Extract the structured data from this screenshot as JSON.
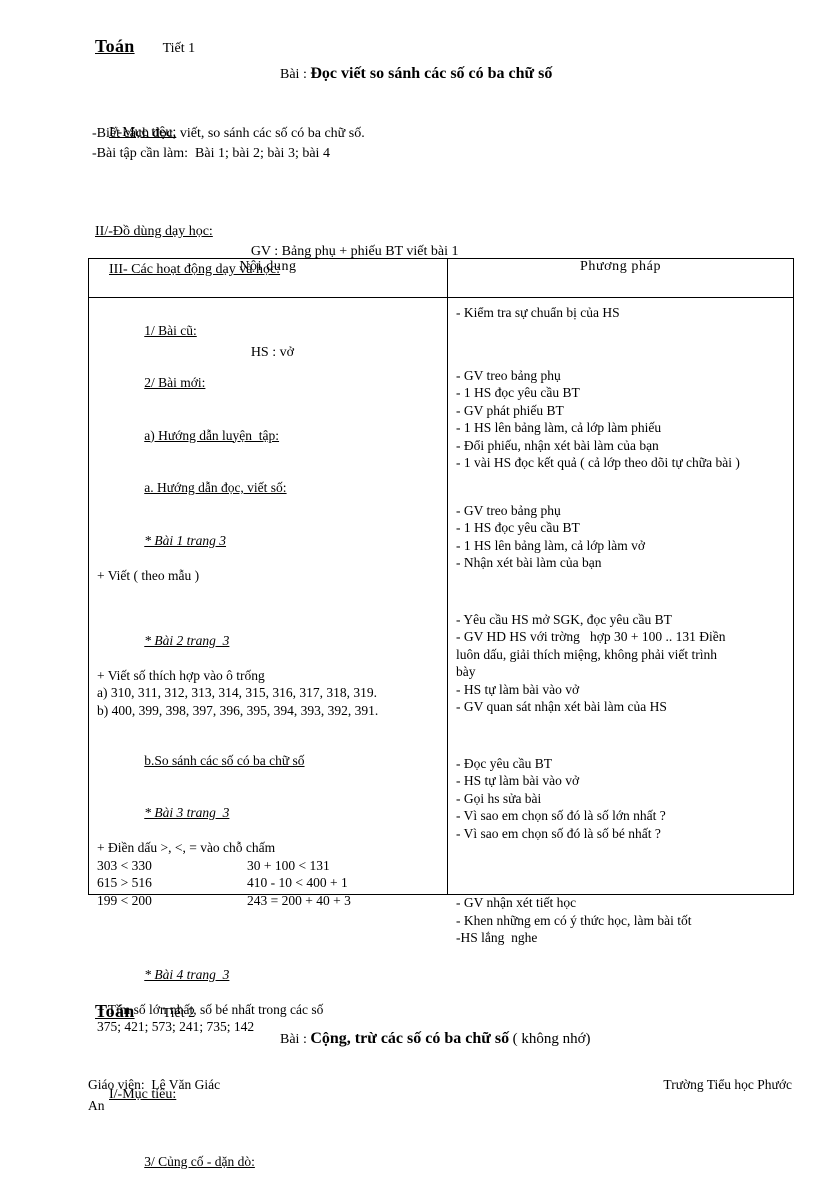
{
  "lesson1": {
    "subject": "Toán",
    "period": "Tiết 1",
    "title_prefix": "Bài :",
    "title_main": "Đọc viết so sánh các số có ba chữ số",
    "title_tail": "",
    "section1_label": "I/-Mục tiêu:",
    "objectives": [
      "-Biết cách đọc, viết, so sánh các số có ba chữ số.",
      "-Bài tập cần làm:  Bài 1; bài 2; bài 3; bài 4"
    ],
    "section2_label": "II/-Đồ dùng dạy học:",
    "materials": [
      "GV : Bảng phụ + phiếu BT viết bài 1",
      "HS : vở"
    ],
    "section3_label": "III- Các hoạt động dạy và học:"
  },
  "table": {
    "headers": {
      "content": "Nội dung",
      "method": "Phương pháp"
    },
    "content_column": {
      "old_lesson": "1/ Bài cũ:",
      "new_lesson": "2/ Bài mới:",
      "part_a": "a) Hướng dẫn luyện  tập:",
      "sub_a": "a. Hướng dẫn đọc, viết số:",
      "ex1_title": "* Bài 1 trang 3",
      "ex1_desc": "+ Viết ( theo mẫu )",
      "ex2_title": "* Bài 2 trang  3",
      "ex2_desc": "+ Viết số thích hợp vào ô trống",
      "ex2_line_a": "a) 310, 311, 312, 313, 314, 315, 316, 317, 318, 319.",
      "ex2_line_b": "b) 400, 399, 398, 397, 396, 395, 394, 393, 392, 391.",
      "part_b": "b.So sánh các số có ba chữ số",
      "ex3_title": "* Bài 3 trang  3",
      "ex3_desc": "+ Điền dấu >, <, = vào chỗ chấm",
      "ex3_pairs": [
        {
          "left": "303 < 330",
          "right": "30 + 100 < 131"
        },
        {
          "left": "615 > 516",
          "right": "410 - 10 < 400 + 1"
        },
        {
          "left": "199 < 200",
          "right": "243 = 200 + 40 + 3"
        }
      ],
      "ex4_title": "* Bài 4 trang  3",
      "ex4_desc": "+ Tìm số lớn nhất, số bé nhất trong các số",
      "ex4_numbers": "375; 421; 573; 241; 735; 142",
      "closing": "3/ Củng cố - dặn dò:"
    },
    "method_column": {
      "group1": [
        "- Kiểm tra sự chuẩn bị của HS"
      ],
      "group2": [
        "- GV treo bảng phụ",
        "- 1 HS đọc yêu cầu BT",
        "- GV phát phiếu BT",
        "- 1 HS lên bảng làm, cả lớp làm phiếu",
        "- Đổi phiếu, nhận xét bài làm của bạn",
        "- 1 vài HS đọc kết quả ( cả lớp theo dõi tự chữa bài )"
      ],
      "group3": [
        "- GV treo bảng phụ",
        "- 1 HS đọc yêu cầu BT",
        "- 1 HS lên bảng làm, cả lớp làm vở",
        "- Nhận xét bài làm của bạn"
      ],
      "group4": [
        "- Yêu cầu HS mở SGK, đọc yêu cầu BT",
        "- GV HD HS với trờng   hợp 30 + 100 .. 131 Điền",
        "luôn dấu, giải thích miệng, không phải viết trình",
        "bày",
        "- HS tự làm bài vào vở",
        "- GV quan sát nhận xét bài làm của HS"
      ],
      "group5": [
        "- Đọc yêu cầu BT",
        "- HS tự làm bài vào vở",
        "- Gọi hs sửa bài",
        "- Vì sao em chọn số đó là số lớn nhất ?",
        "- Vì sao em chọn số đó là số bé nhất ?"
      ],
      "group6": [
        "- GV nhận xét tiết học",
        "- Khen những em có ý thức học, làm bài tốt",
        "-HS lắng  nghe"
      ]
    }
  },
  "lesson2": {
    "subject": "Toán",
    "period": "Tiết 2",
    "title_prefix": "Bài :",
    "title_main": "Cộng, trừ các số có ba chữ số",
    "title_tail": "( không nhớ)",
    "section1_label": "I/-Mục tiêu:"
  },
  "footer": {
    "teacher": "Giáo viên:  Lê Văn Giác",
    "school": "Trường Tiểu học Phước An",
    "school_line1": "Trường Tiểu học Phước",
    "school_line2": "An"
  }
}
